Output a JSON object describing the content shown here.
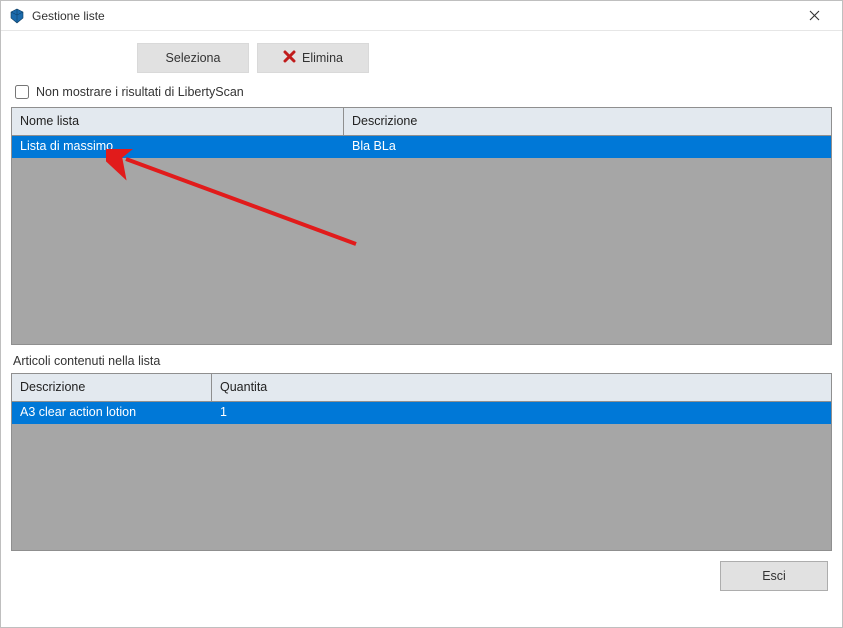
{
  "window": {
    "title": "Gestione liste"
  },
  "toolbar": {
    "seleziona_label": "Seleziona",
    "elimina_label": "Elimina"
  },
  "checkbox": {
    "hide_libertyscan_label": "Non mostrare i risultati di LibertyScan"
  },
  "lists_grid": {
    "headers": {
      "name": "Nome lista",
      "description": "Descrizione"
    },
    "rows": [
      {
        "name": "Lista di massimo",
        "description": "Bla BLa",
        "selected": true
      }
    ]
  },
  "articles_section_label": "Articoli contenuti nella lista",
  "articles_grid": {
    "headers": {
      "description": "Descrizione",
      "quantity": "Quantita"
    },
    "rows": [
      {
        "description": "A3 clear action lotion",
        "quantity": "1",
        "selected": true
      }
    ]
  },
  "footer": {
    "esci_label": "Esci"
  },
  "colors": {
    "selection": "#0078d7",
    "grid_bg": "#a6a6a6",
    "header_bg": "#e3e9ef",
    "btn_bg": "#e1e1e1"
  }
}
